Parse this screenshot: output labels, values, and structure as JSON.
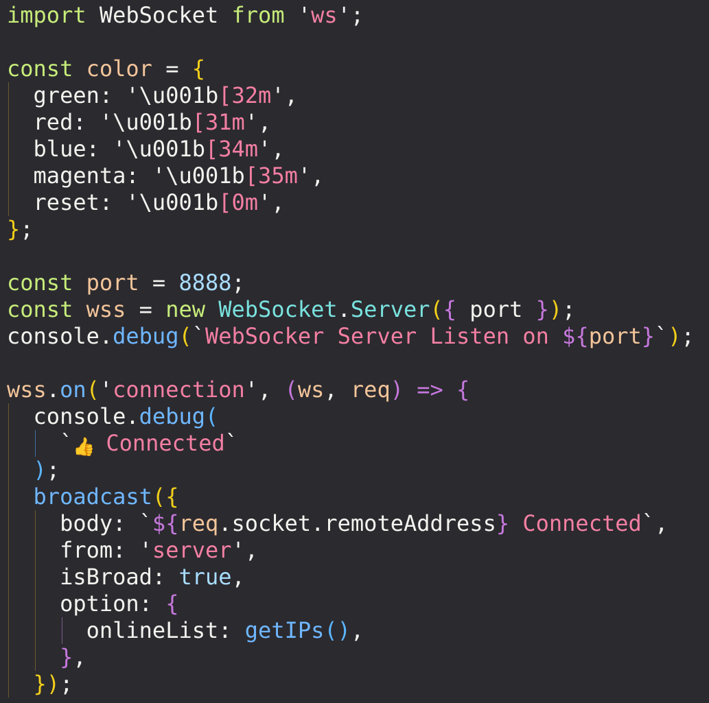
{
  "colors": {
    "background": "#2b2a2f",
    "default": "#f2f2ef",
    "keyword": "#c6ec7a",
    "variable": "#f3c59a",
    "string": "#f47fa3",
    "property": "#f3f3ef",
    "bracket_yellow": "#f2cf1a",
    "bracket_purple": "#c678dd",
    "bracket_blue": "#5bb6ff",
    "function": "#6fb7ff",
    "constant": "#a9ddff",
    "class": "#79e2de",
    "punctuation": "#f2f2ef"
  },
  "lines": [
    {
      "tokens": [
        {
          "text": "import",
          "color": "keyword"
        },
        {
          "text": " WebSocket ",
          "color": "property"
        },
        {
          "text": "from",
          "color": "keyword"
        },
        {
          "text": " '",
          "color": "default"
        },
        {
          "text": "ws",
          "color": "string"
        },
        {
          "text": "';",
          "color": "default"
        }
      ]
    },
    {
      "tokens": []
    },
    {
      "tokens": [
        {
          "text": "const",
          "color": "keyword"
        },
        {
          "text": " color ",
          "color": "variable"
        },
        {
          "text": "= ",
          "color": "default"
        },
        {
          "text": "{",
          "color": "bracket_yellow"
        }
      ]
    },
    {
      "tokens": [
        {
          "text": "  green",
          "color": "property"
        },
        {
          "text": ": '",
          "color": "default"
        },
        {
          "text": "\\u001b",
          "color": "property"
        },
        {
          "text": "[32m",
          "color": "string"
        },
        {
          "text": "',",
          "color": "default"
        }
      ]
    },
    {
      "tokens": [
        {
          "text": "  red",
          "color": "property"
        },
        {
          "text": ": '",
          "color": "default"
        },
        {
          "text": "\\u001b",
          "color": "property"
        },
        {
          "text": "[31m",
          "color": "string"
        },
        {
          "text": "',",
          "color": "default"
        }
      ]
    },
    {
      "tokens": [
        {
          "text": "  blue",
          "color": "property"
        },
        {
          "text": ": '",
          "color": "default"
        },
        {
          "text": "\\u001b",
          "color": "property"
        },
        {
          "text": "[34m",
          "color": "string"
        },
        {
          "text": "',",
          "color": "default"
        }
      ]
    },
    {
      "tokens": [
        {
          "text": "  magenta",
          "color": "property"
        },
        {
          "text": ": '",
          "color": "default"
        },
        {
          "text": "\\u001b",
          "color": "property"
        },
        {
          "text": "[35m",
          "color": "string"
        },
        {
          "text": "',",
          "color": "default"
        }
      ]
    },
    {
      "tokens": [
        {
          "text": "  reset",
          "color": "property"
        },
        {
          "text": ": '",
          "color": "default"
        },
        {
          "text": "\\u001b",
          "color": "property"
        },
        {
          "text": "[0m",
          "color": "string"
        },
        {
          "text": "',",
          "color": "default"
        }
      ]
    },
    {
      "tokens": [
        {
          "text": "}",
          "color": "bracket_yellow"
        },
        {
          "text": ";",
          "color": "default"
        }
      ]
    },
    {
      "tokens": []
    },
    {
      "tokens": [
        {
          "text": "const",
          "color": "keyword"
        },
        {
          "text": " port ",
          "color": "variable"
        },
        {
          "text": "= ",
          "color": "default"
        },
        {
          "text": "8888",
          "color": "constant"
        },
        {
          "text": ";",
          "color": "default"
        }
      ]
    },
    {
      "tokens": [
        {
          "text": "const",
          "color": "keyword"
        },
        {
          "text": " wss ",
          "color": "variable"
        },
        {
          "text": "= ",
          "color": "default"
        },
        {
          "text": "new",
          "color": "keyword"
        },
        {
          "text": " WebSocket",
          "color": "class"
        },
        {
          "text": ".",
          "color": "default"
        },
        {
          "text": "Server",
          "color": "class"
        },
        {
          "text": "(",
          "color": "bracket_yellow"
        },
        {
          "text": "{",
          "color": "bracket_purple"
        },
        {
          "text": " port ",
          "color": "property"
        },
        {
          "text": "}",
          "color": "bracket_purple"
        },
        {
          "text": ")",
          "color": "bracket_yellow"
        },
        {
          "text": ";",
          "color": "default"
        }
      ]
    },
    {
      "tokens": [
        {
          "text": "console",
          "color": "property"
        },
        {
          "text": ".",
          "color": "default"
        },
        {
          "text": "debug",
          "color": "function"
        },
        {
          "text": "(",
          "color": "bracket_yellow"
        },
        {
          "text": "`",
          "color": "default"
        },
        {
          "text": "WebSocker Server Listen on ",
          "color": "string"
        },
        {
          "text": "${",
          "color": "bracket_purple"
        },
        {
          "text": "port",
          "color": "variable"
        },
        {
          "text": "}",
          "color": "bracket_purple"
        },
        {
          "text": "`",
          "color": "default"
        },
        {
          "text": ")",
          "color": "bracket_yellow"
        },
        {
          "text": ";",
          "color": "default"
        }
      ]
    },
    {
      "tokens": []
    },
    {
      "tokens": [
        {
          "text": "wss",
          "color": "variable"
        },
        {
          "text": ".",
          "color": "default"
        },
        {
          "text": "on",
          "color": "function"
        },
        {
          "text": "(",
          "color": "bracket_yellow"
        },
        {
          "text": "'",
          "color": "default"
        },
        {
          "text": "connection",
          "color": "string"
        },
        {
          "text": "', ",
          "color": "default"
        },
        {
          "text": "(",
          "color": "bracket_purple"
        },
        {
          "text": "ws",
          "color": "variable"
        },
        {
          "text": ", ",
          "color": "default"
        },
        {
          "text": "req",
          "color": "variable"
        },
        {
          "text": ")",
          "color": "bracket_purple"
        },
        {
          "text": " => ",
          "color": "bracket_purple"
        },
        {
          "text": "{",
          "color": "bracket_purple"
        }
      ]
    },
    {
      "tokens": [
        {
          "text": "  console",
          "color": "property"
        },
        {
          "text": ".",
          "color": "default"
        },
        {
          "text": "debug",
          "color": "function"
        },
        {
          "text": "(",
          "color": "bracket_blue"
        }
      ]
    },
    {
      "tokens": [
        {
          "text": "    `",
          "color": "default"
        },
        {
          "text": "👍",
          "color": "emoji"
        },
        {
          "text": "Connected",
          "color": "string"
        },
        {
          "text": "`",
          "color": "default"
        }
      ]
    },
    {
      "tokens": [
        {
          "text": "  ",
          "color": "default"
        },
        {
          "text": ")",
          "color": "bracket_blue"
        },
        {
          "text": ";",
          "color": "default"
        }
      ]
    },
    {
      "tokens": [
        {
          "text": "  broadcast",
          "color": "function"
        },
        {
          "text": "(",
          "color": "bracket_yellow"
        },
        {
          "text": "{",
          "color": "bracket_yellow"
        }
      ]
    },
    {
      "tokens": [
        {
          "text": "    body",
          "color": "property"
        },
        {
          "text": ": `",
          "color": "default"
        },
        {
          "text": "${",
          "color": "bracket_purple"
        },
        {
          "text": "req",
          "color": "variable"
        },
        {
          "text": ".socket.remoteAddress",
          "color": "property"
        },
        {
          "text": "}",
          "color": "bracket_purple"
        },
        {
          "text": " Connected",
          "color": "string"
        },
        {
          "text": "`,",
          "color": "default"
        }
      ]
    },
    {
      "tokens": [
        {
          "text": "    from",
          "color": "property"
        },
        {
          "text": ": '",
          "color": "default"
        },
        {
          "text": "server",
          "color": "string"
        },
        {
          "text": "',",
          "color": "default"
        }
      ]
    },
    {
      "tokens": [
        {
          "text": "    isBroad",
          "color": "property"
        },
        {
          "text": ": ",
          "color": "default"
        },
        {
          "text": "true",
          "color": "constant"
        },
        {
          "text": ",",
          "color": "default"
        }
      ]
    },
    {
      "tokens": [
        {
          "text": "    option",
          "color": "property"
        },
        {
          "text": ": ",
          "color": "default"
        },
        {
          "text": "{",
          "color": "bracket_purple"
        }
      ]
    },
    {
      "tokens": [
        {
          "text": "      onlineList",
          "color": "property"
        },
        {
          "text": ": ",
          "color": "default"
        },
        {
          "text": "getIPs",
          "color": "function"
        },
        {
          "text": "()",
          "color": "bracket_blue"
        },
        {
          "text": ",",
          "color": "default"
        }
      ]
    },
    {
      "tokens": [
        {
          "text": "    ",
          "color": "default"
        },
        {
          "text": "}",
          "color": "bracket_purple"
        },
        {
          "text": ",",
          "color": "default"
        }
      ]
    },
    {
      "tokens": [
        {
          "text": "  ",
          "color": "default"
        },
        {
          "text": "}",
          "color": "bracket_yellow"
        },
        {
          "text": ")",
          "color": "bracket_yellow"
        },
        {
          "text": ";",
          "color": "default"
        }
      ]
    }
  ]
}
